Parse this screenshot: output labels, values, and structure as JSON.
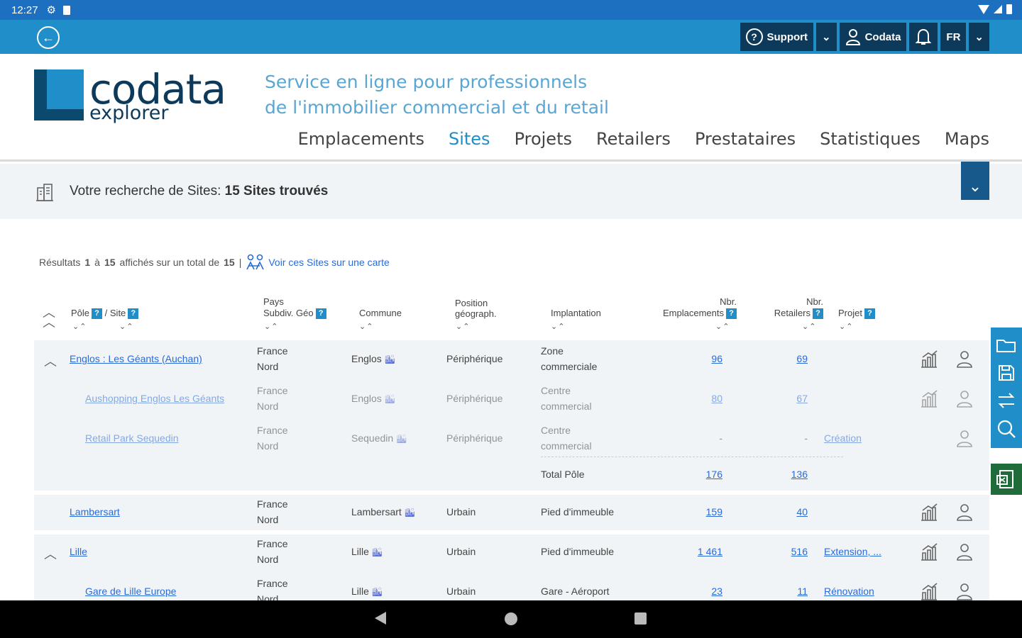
{
  "status": {
    "time": "12:27"
  },
  "topbar": {
    "support_label": "Support",
    "user_label": "Codata",
    "lang_label": "FR"
  },
  "brand": {
    "name": "codata",
    "sub": "explorer"
  },
  "tagline": [
    "Service en ligne pour professionnels",
    "de l'immobilier commercial et du retail"
  ],
  "nav": [
    {
      "label": "Emplacements",
      "active": false
    },
    {
      "label": "Sites",
      "active": true
    },
    {
      "label": "Projets",
      "active": false
    },
    {
      "label": "Retailers",
      "active": false
    },
    {
      "label": "Prestataires",
      "active": false
    },
    {
      "label": "Statistiques",
      "active": false
    },
    {
      "label": "Maps",
      "active": false
    }
  ],
  "search": {
    "prefix": "Votre recherche de Sites:",
    "count": "15 Sites trouvés"
  },
  "results": {
    "text_a": "Résultats",
    "from": "1",
    "text_b": "à",
    "to": "15",
    "text_c": "affichés sur un total de",
    "total": "15",
    "sep": "|",
    "map_link": "Voir ces Sites sur une carte"
  },
  "columns": {
    "pole": "Pôle",
    "site": "/ Site",
    "pays_1": "Pays",
    "pays_2": "Subdiv. Géo",
    "commune": "Commune",
    "position_1": "Position",
    "position_2": "géograph.",
    "implantation": "Implantation",
    "empl_1": "Nbr.",
    "empl_2": "Emplacements",
    "ret_1": "Nbr.",
    "ret_2": "Retailers",
    "projet": "Projet",
    "help": "?",
    "sort": "⌄⌃"
  },
  "rows": [
    {
      "name": "Englos : Les Géants (Auchan)",
      "country": "France",
      "region": "Nord",
      "commune": "Englos",
      "position": "Périphérique",
      "impl_1": "Zone",
      "impl_2": "commerciale",
      "empl": "96",
      "ret": "69",
      "projet": ""
    },
    {
      "name": "Aushopping Englos Les Géants",
      "country": "France",
      "region": "Nord",
      "commune": "Englos",
      "position": "Périphérique",
      "impl_1": "Centre",
      "impl_2": "commercial",
      "empl": "80",
      "ret": "67",
      "projet": ""
    },
    {
      "name": "Retail Park Sequedin",
      "country": "France",
      "region": "Nord",
      "commune": "Sequedin",
      "position": "Périphérique",
      "impl_1": "Centre",
      "impl_2": "commercial",
      "empl": "-",
      "ret": "-",
      "projet": "Création"
    },
    {
      "name": "Lambersart",
      "country": "France",
      "region": "Nord",
      "commune": "Lambersart",
      "position": "Urbain",
      "impl_1": "Pied d'immeuble",
      "impl_2": "",
      "empl": "159",
      "ret": "40",
      "projet": ""
    },
    {
      "name": "Lille",
      "country": "France",
      "region": "Nord",
      "commune": "Lille",
      "position": "Urbain",
      "impl_1": "Pied d'immeuble",
      "impl_2": "",
      "empl": "1 461",
      "ret": "516",
      "projet": "Extension, ..."
    },
    {
      "name": "Gare de Lille Europe",
      "country": "France",
      "region": "Nord",
      "commune": "Lille",
      "position": "Urbain",
      "impl_1": "Gare - Aéroport",
      "impl_2": "",
      "empl": "23",
      "ret": "11",
      "projet": "Rénovation"
    }
  ],
  "total_pole": {
    "label": "Total Pôle",
    "empl": "176",
    "ret": "136"
  },
  "colors": {
    "primary": "#1f8ec9",
    "dark": "#0d3a5a",
    "link": "#2a6bd6",
    "row_bg": "#f1f4f6",
    "export": "#1f6b3a"
  },
  "icons": [
    "back-icon",
    "help-circle-icon",
    "chevron-down-icon",
    "user-icon",
    "bell-icon",
    "building-icon",
    "map-group-icon",
    "stats-icon",
    "person-pin-icon",
    "folder-icon",
    "save-icon",
    "swap-icon",
    "search-icon",
    "export-icon"
  ]
}
